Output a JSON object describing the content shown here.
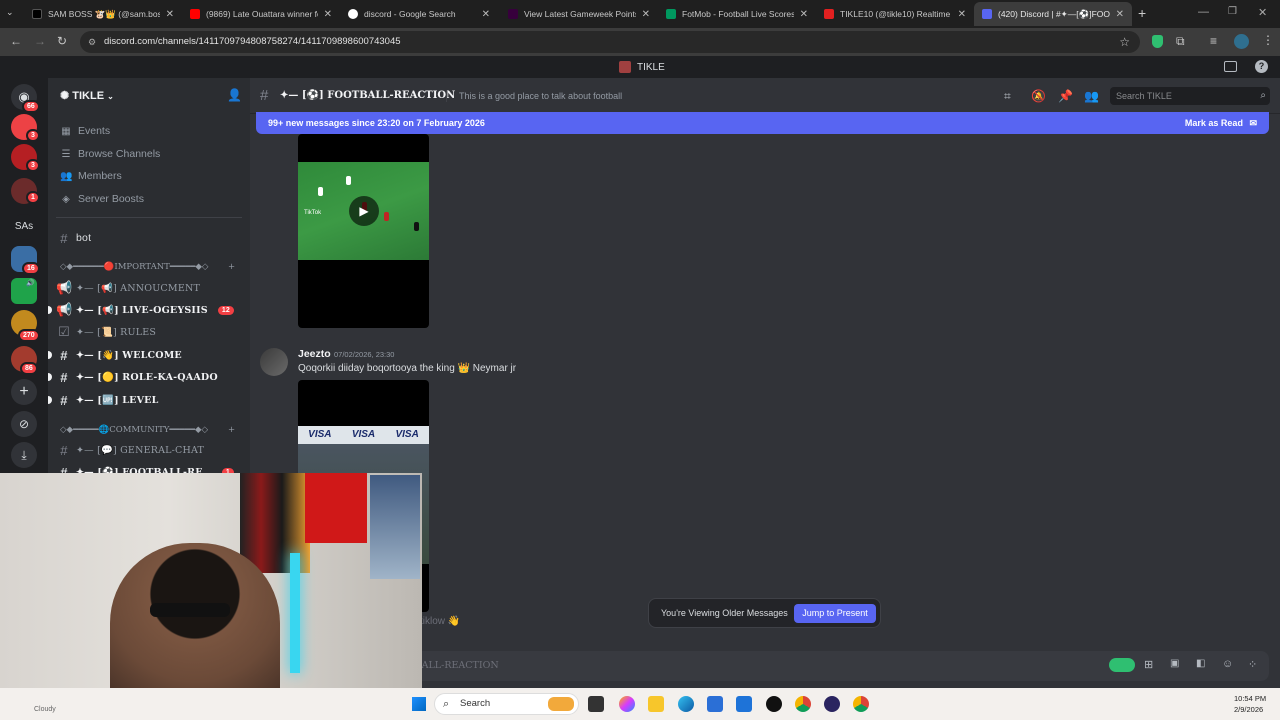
{
  "browser": {
    "tabs": [
      {
        "title": "SAM BOSS 🐮👑 (@sam.boss...",
        "favicon_color": "#000000"
      },
      {
        "title": "(9869) Late Ouattara winner fo...",
        "favicon_color": "#ff0000"
      },
      {
        "title": "discord - Google Search",
        "favicon_color": "#4285f4"
      },
      {
        "title": "View Latest Gameweek Points |",
        "favicon_color": "#37003c"
      },
      {
        "title": "FotMob - Football Live Scores",
        "favicon_color": "#00985f"
      },
      {
        "title": "TIKLE10 (@tikle10) Realtime Ki...",
        "favicon_color": "#e22020"
      },
      {
        "title": "(420) Discord | #✦—[⚽]FOOT...",
        "favicon_color": "#5865f2"
      }
    ],
    "url": "discord.com/channels/1411709794808758274/1411709898600743045"
  },
  "discord": {
    "window_title": "TIKLE",
    "servers": [
      {
        "name": "direct-messages",
        "badge": "66",
        "color": "#5865f2"
      },
      {
        "name": "server-2",
        "badge": "3",
        "color": "#ed4245"
      },
      {
        "name": "server-3",
        "badge": "3",
        "color": "#b51f23"
      },
      {
        "name": "server-4",
        "badge": "1",
        "color": "#6b2b2b"
      },
      {
        "name": "SAs",
        "badge": "",
        "color": "#1e1f22"
      },
      {
        "name": "server-6",
        "badge": "16",
        "color": "#3a6ea5"
      },
      {
        "name": "server-7",
        "badge": "",
        "color": "#1fa34a"
      },
      {
        "name": "server-8",
        "badge": "270",
        "color": "#c28a1e"
      },
      {
        "name": "server-9",
        "badge": "86",
        "color": "#a33b2e"
      }
    ],
    "sas_label": "SAs",
    "guild": {
      "name": "TIKLE"
    },
    "menu": [
      {
        "icon": "calendar-icon",
        "label": "Events"
      },
      {
        "icon": "browse-icon",
        "label": "Browse Channels"
      },
      {
        "icon": "members-icon",
        "label": "Members"
      },
      {
        "icon": "boost-icon",
        "label": "Server Boosts"
      }
    ],
    "channels_top": [
      {
        "label": "bot"
      }
    ],
    "category_important": "◇◆━━━━━━🔴IMPORTANT━━━━━◆◇",
    "important_channels": [
      {
        "label": "✦— [📢] ANNOUCMENT",
        "unread": false,
        "badge": ""
      },
      {
        "label": "✦— [📢] LIVE-OGEYSIIS",
        "unread": true,
        "badge": "12"
      },
      {
        "label": "✦— [📜] RULES",
        "unread": false,
        "badge": ""
      },
      {
        "label": "✦— [👋] WELCOME",
        "unread": true,
        "badge": ""
      },
      {
        "label": "✦— [🟡] ROLE-KA-QAADO",
        "unread": true,
        "badge": ""
      },
      {
        "label": "✦— [🆙] LEVEL",
        "unread": true,
        "badge": ""
      }
    ],
    "category_community": "◇◆━━━━━🌐COMMUNITY━━━━━◆◇",
    "community_channels": [
      {
        "label": "✦— [💬] GENERAL-CHAT",
        "unread": false,
        "badge": ""
      },
      {
        "label": "✦— [⚽] FOOTBALL-RE...",
        "unread": true,
        "badge": "1"
      }
    ],
    "channel": {
      "name": "✦— [⚽] FOOTBALL-REACTION",
      "topic": "This is a good place to talk about football"
    },
    "search_placeholder": "Search TIKLE",
    "new_messages_bar": {
      "text": "99+ new messages since 23:20 on 7 February 2026",
      "action": "Mark as Read"
    },
    "messages": [
      {
        "author": "Jeezto",
        "timestamp": "07/02/2026, 23:30",
        "text": "Qoqorkii diiday boqortooya the king 👑 Neymar jr"
      }
    ],
    "video_caption_tiktok": "TikTok",
    "visa_label": "VISA",
    "trailing_text": "tiklow 👋",
    "older_messages": {
      "label": "You're Viewing Older Messages",
      "button": "Jump to Present"
    },
    "composer_placeholder": "Message #✦—[⚽]FOOTBALL-REACTION"
  },
  "taskbar": {
    "search_label": "Search",
    "time": "10:54 PM",
    "date": "2/9/2026",
    "weather": "Cloudy"
  }
}
